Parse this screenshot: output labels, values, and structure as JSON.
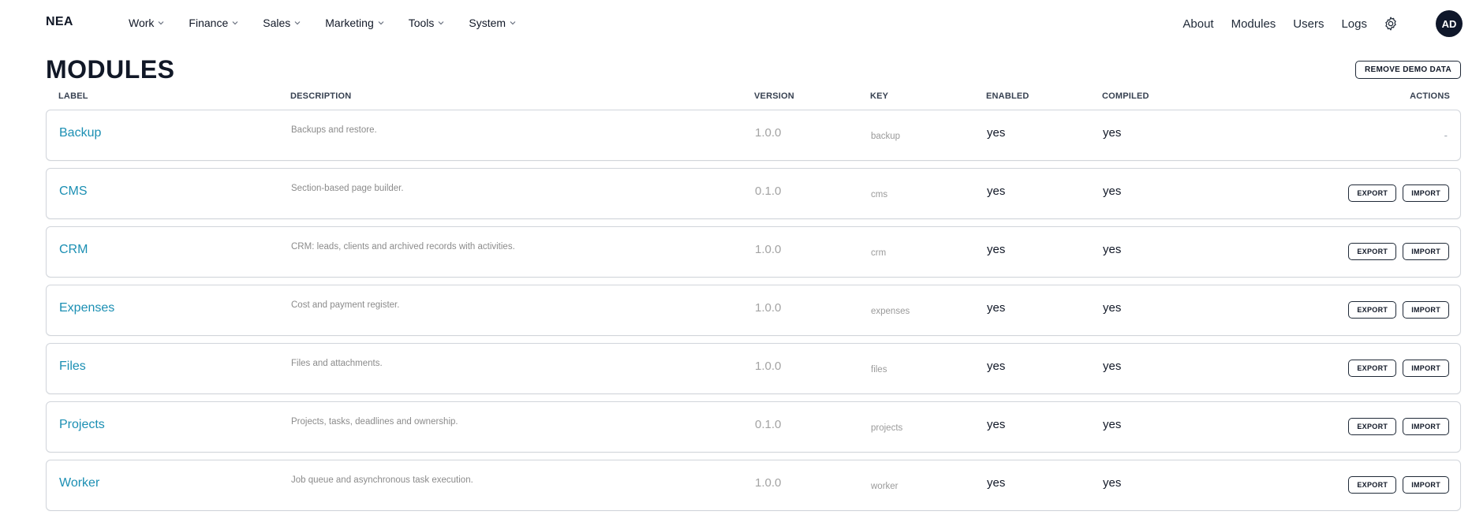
{
  "brand": "NEA",
  "menu": [
    "Work",
    "Finance",
    "Sales",
    "Marketing",
    "Tools",
    "System"
  ],
  "right_nav": {
    "about": "About",
    "modules": "Modules",
    "users": "Users",
    "logs": "Logs"
  },
  "avatar": "AD",
  "page_title": "MODULES",
  "remove_demo_label": "REMOVE DEMO DATA",
  "columns": {
    "label": "LABEL",
    "description": "DESCRIPTION",
    "version": "VERSION",
    "key": "KEY",
    "enabled": "ENABLED",
    "compiled": "COMPILED",
    "actions": "ACTIONS"
  },
  "actions": {
    "export": "EXPORT",
    "import": "IMPORT",
    "none": "-"
  },
  "modules": [
    {
      "label": "Backup",
      "description": "Backups and restore.",
      "version": "1.0.0",
      "key": "backup",
      "enabled": "yes",
      "compiled": "yes",
      "has_actions": false
    },
    {
      "label": "CMS",
      "description": "Section-based page builder.",
      "version": "0.1.0",
      "key": "cms",
      "enabled": "yes",
      "compiled": "yes",
      "has_actions": true
    },
    {
      "label": "CRM",
      "description": "CRM: leads, clients and archived records with activities.",
      "version": "1.0.0",
      "key": "crm",
      "enabled": "yes",
      "compiled": "yes",
      "has_actions": true
    },
    {
      "label": "Expenses",
      "description": "Cost and payment register.",
      "version": "1.0.0",
      "key": "expenses",
      "enabled": "yes",
      "compiled": "yes",
      "has_actions": true
    },
    {
      "label": "Files",
      "description": "Files and attachments.",
      "version": "1.0.0",
      "key": "files",
      "enabled": "yes",
      "compiled": "yes",
      "has_actions": true
    },
    {
      "label": "Projects",
      "description": "Projects, tasks, deadlines and ownership.",
      "version": "0.1.0",
      "key": "projects",
      "enabled": "yes",
      "compiled": "yes",
      "has_actions": true
    },
    {
      "label": "Worker",
      "description": "Job queue and asynchronous task execution.",
      "version": "1.0.0",
      "key": "worker",
      "enabled": "yes",
      "compiled": "yes",
      "has_actions": true
    }
  ]
}
